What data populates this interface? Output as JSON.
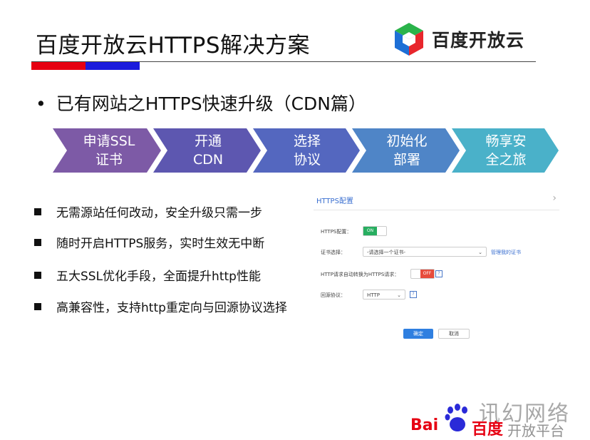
{
  "slide": {
    "title": "百度开放云HTTPS解决方案",
    "logo_text": "百度开放云",
    "subheading_bullet": "•",
    "subheading": "已有网站之HTTPS快速升级（CDN篇）"
  },
  "steps": [
    {
      "label": "申请SSL\n证书",
      "color": "#7d5aa6"
    },
    {
      "label": "开通\nCDN",
      "color": "#5d57b0"
    },
    {
      "label": "选择\n协议",
      "color": "#5467bf"
    },
    {
      "label": "初始化\n部署",
      "color": "#4f85c7"
    },
    {
      "label": "畅享安\n全之旅",
      "color": "#4ab1c9"
    }
  ],
  "bullets": [
    "无需源站任何改动，安全升级只需一步",
    "随时开启HTTPS服务，实时生效无中断",
    "五大SSL优化手段，全面提升http性能",
    "高兼容性，支持http重定向与回源协议选择"
  ],
  "config": {
    "panel_title": "HTTPS配置",
    "https_label": "HTTPS配置：",
    "https_toggle": "ON",
    "cert_label": "证书选择：",
    "cert_select": "-请选择一个证书-",
    "cert_link": "管理我的证书",
    "redirect_label": "HTTP请求自动转换为HTTPS请求：",
    "redirect_toggle": "OFF",
    "origin_label": "回源协议：",
    "origin_select": "HTTP",
    "help_icon": "?",
    "confirm_button": "确定",
    "cancel_button": "取消"
  },
  "watermark": {
    "baidu_left": "Bai",
    "baidu_right": "百度",
    "site_name": "讯幻网络",
    "site_sub": "开放平台"
  }
}
